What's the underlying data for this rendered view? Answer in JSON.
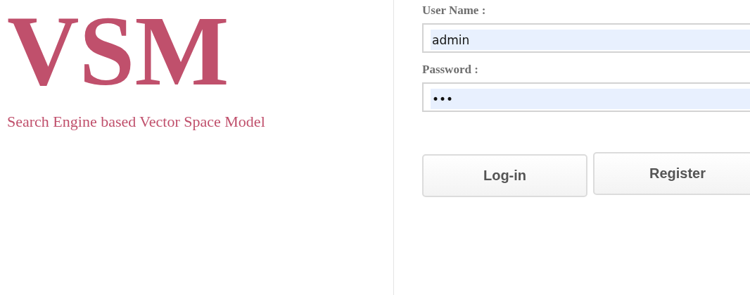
{
  "brand": {
    "logo": "VSM",
    "tagline": "Search Engine based Vector Space Model"
  },
  "login": {
    "fields": [
      {
        "label": "User Name :",
        "value": "admin",
        "autofilled": true
      },
      {
        "label": "Password :",
        "value": "•••",
        "autofilled": true
      }
    ],
    "buttons": [
      "Log-in",
      "Register"
    ]
  }
}
